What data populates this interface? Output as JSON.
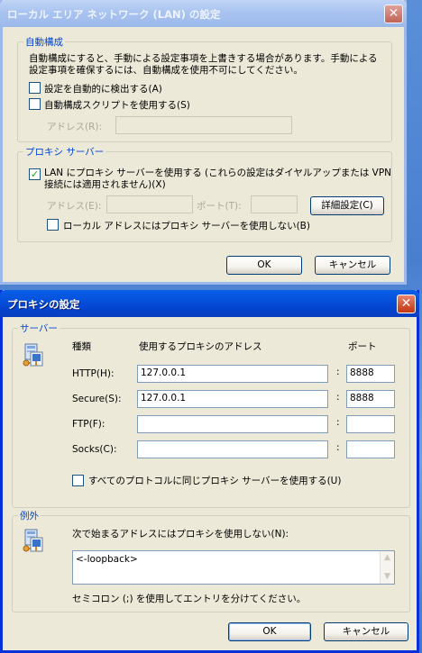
{
  "lan_dialog": {
    "title": "ローカル エリア ネットワーク (LAN) の設定",
    "auto_group": {
      "label": "自動構成",
      "desc_line1": "自動構成にすると、手動による設定事項を上書きする場合があります。手動による",
      "desc_line2": "設定事項を確保するには、自動構成を使用不可にしてください。",
      "auto_detect_label": "設定を自動的に検出する(A)",
      "auto_script_label": "自動構成スクリプトを使用する(S)",
      "address_label": "アドレス(R):",
      "address_value": ""
    },
    "proxy_group": {
      "label": "プロキシ サーバー",
      "use_proxy_line1": "LAN にプロキシ サーバーを使用する (これらの設定はダイヤルアップまたは VPN",
      "use_proxy_line2": "接続には適用されません)(X)",
      "address_label": "アドレス(E):",
      "port_label": "ポート(T):",
      "advanced_button": "詳細設定(C)",
      "bypass_local_label": "ローカル アドレスにはプロキシ サーバーを使用しない(B)"
    },
    "ok": "OK",
    "cancel": "キャンセル",
    "checks": {
      "auto_detect": false,
      "auto_script": false,
      "use_proxy": true,
      "bypass_local": false
    }
  },
  "proxy_dialog": {
    "title": "プロキシの設定",
    "servers_group": {
      "label": "サーバー",
      "col_type": "種類",
      "col_address": "使用するプロキシのアドレス",
      "col_port": "ポート",
      "rows": [
        {
          "label": "HTTP(H):",
          "address": "127.0.0.1",
          "port": "8888"
        },
        {
          "label": "Secure(S):",
          "address": "127.0.0.1",
          "port": "8888"
        },
        {
          "label": "FTP(F):",
          "address": "",
          "port": ""
        },
        {
          "label": "Socks(C):",
          "address": "",
          "port": ""
        }
      ],
      "colon": ":",
      "same_proxy_label": "すべてのプロトコルに同じプロキシ サーバーを使用する(U)",
      "same_proxy_checked": false
    },
    "exceptions_group": {
      "label": "例外",
      "desc": "次で始まるアドレスにはプロキシを使用しない(N):",
      "value": "<-loopback>",
      "hint": "セミコロン (;) を使用してエントリを分けてください。"
    },
    "ok": "OK",
    "cancel": "キャンセル"
  },
  "icons": {
    "close": "close-icon",
    "server": "server-icon",
    "scroll_up": "chevron-up-icon",
    "scroll_down": "chevron-down-icon"
  },
  "colors": {
    "group_label": "#0046d5",
    "active_title": "#0550dc",
    "inactive_title": "#a9c4f0",
    "check": "#21a121"
  }
}
